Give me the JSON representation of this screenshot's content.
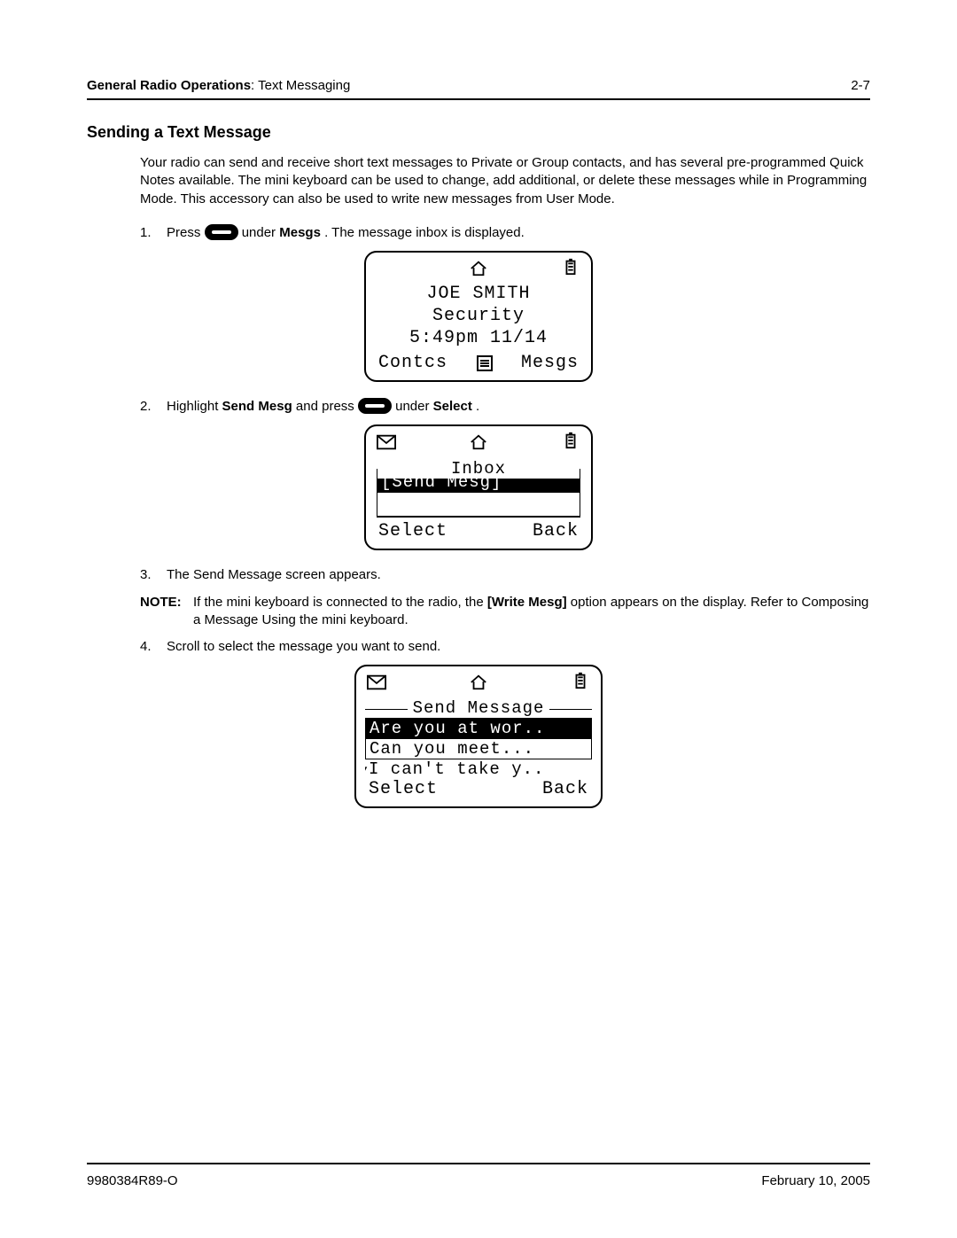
{
  "header": {
    "title_bold": "General Radio Operations",
    "title_rest": ": Text Messaging",
    "page_number": "2-7"
  },
  "section_heading": "Sending a Text Message",
  "intro": "Your radio can send and receive short text messages to Private or Group contacts, and has several pre-programmed Quick Notes available. The mini keyboard can be used to change, add additional, or delete these messages while in Programming Mode. This accessory can also be used to write new messages from User Mode.",
  "step1": {
    "num": "1.",
    "pre": "Press ",
    "mid": " under ",
    "bold": "Mesgs",
    "post": ". The message inbox is displayed."
  },
  "screen1": {
    "line1": "JOE SMITH",
    "line2": "Security",
    "line3": "5:49pm  11/14",
    "soft_left": "Contcs",
    "soft_right": "Mesgs"
  },
  "step2": {
    "num": "2.",
    "pre": "Highlight ",
    "bold1": "Send Mesg",
    "mid1": " and press ",
    "mid2": " under ",
    "bold2": "Select",
    "post": "."
  },
  "screen2": {
    "legend": "Inbox",
    "selected": "[Send Mesg]",
    "soft_left": "Select",
    "soft_right": "Back"
  },
  "step3": {
    "num": "3.",
    "text": "The Send Message screen appears."
  },
  "note": {
    "label": "NOTE:",
    "pre": "If the mini keyboard is connected to the radio, the ",
    "bold": "[Write Mesg]",
    "post": " option appears on the display. Refer to Composing a Message Using the mini keyboard."
  },
  "step4": {
    "num": "4.",
    "text": "Scroll to select the message you want to send."
  },
  "screen3": {
    "legend": "Send Message",
    "items": [
      "Are you at wor..",
      "Can you meet...",
      "I can't take y.."
    ],
    "soft_left": "Select",
    "soft_right": "Back"
  },
  "footer": {
    "left": "9980384R89-O",
    "right": "February 10, 2005"
  }
}
